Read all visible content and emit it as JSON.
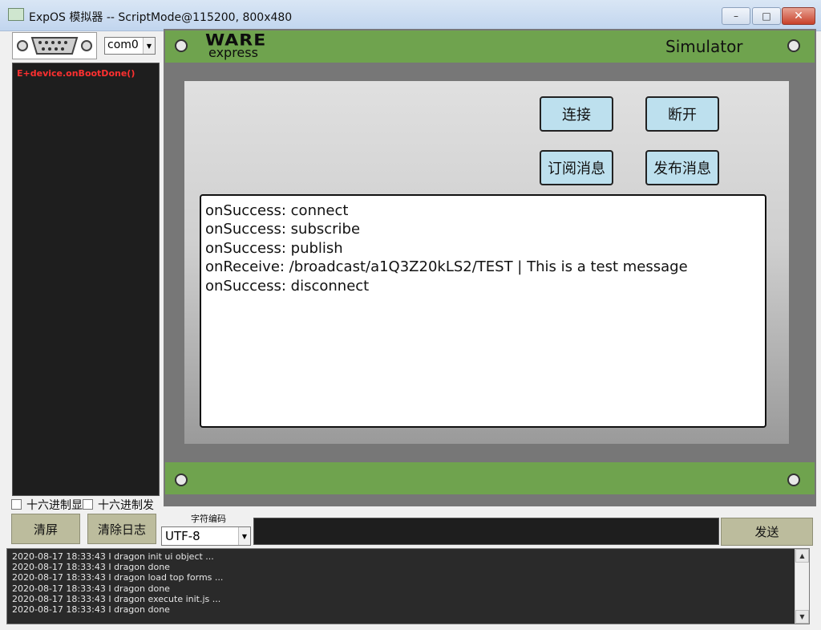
{
  "window": {
    "title": "ExpOS 模拟器 -- ScriptMode@115200, 800x480",
    "minimize": "–",
    "maximize": "□",
    "close": "✕"
  },
  "left_panel": {
    "port_icon": "serial-port-icon",
    "port_select": "com0",
    "console_lines": [
      "E+device.onBootDone()"
    ],
    "checkbox_hex_display": "十六进制显",
    "checkbox_hex_send": "十六进制发",
    "clear_screen": "清屏",
    "clear_log": "清除日志"
  },
  "send_bar": {
    "encoding_label": "字符编码",
    "encoding_value": "UTF-8",
    "send_label": "发送"
  },
  "simulator": {
    "brand_top": "WARE",
    "brand_bottom": "express",
    "title": "Simulator",
    "buttons": {
      "connect": "连接",
      "disconnect": "断开",
      "subscribe": "订阅消息",
      "publish": "发布消息"
    },
    "output_lines": [
      "onSuccess: connect",
      "onSuccess: subscribe",
      "onSuccess: publish",
      "onReceive: /broadcast/a1Q3Z20kLS2/TEST | This is a test message",
      "onSuccess: disconnect"
    ]
  },
  "log": {
    "lines": [
      "2020-08-17 18:33:43 I dragon init ui object ...",
      "2020-08-17 18:33:43 I dragon done",
      "2020-08-17 18:33:43 I dragon load top forms ...",
      "2020-08-17 18:33:43 I dragon done",
      "2020-08-17 18:33:43 I dragon execute init.js ...",
      "2020-08-17 18:33:43 I dragon done"
    ]
  }
}
